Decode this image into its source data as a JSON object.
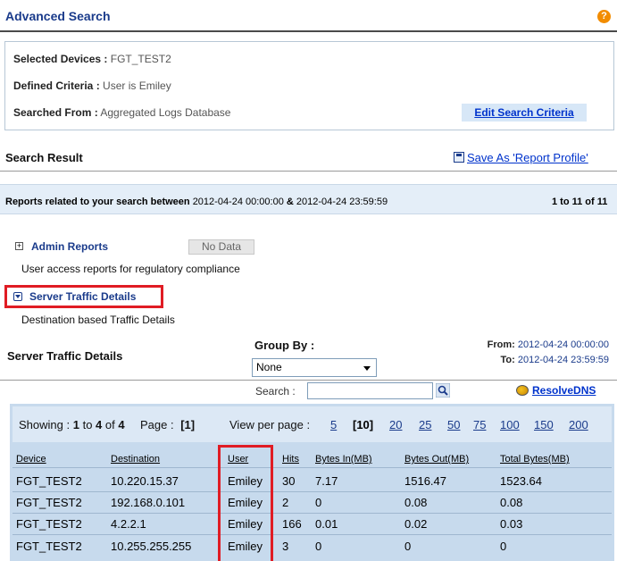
{
  "header": {
    "title": "Advanced Search",
    "help_glyph": "?"
  },
  "criteria": {
    "selected_devices_label": "Selected Devices :",
    "selected_devices_value": "FGT_TEST2",
    "defined_criteria_label": "Defined Criteria :",
    "defined_criteria_value": "User is Emiley",
    "searched_from_label": "Searched From :",
    "searched_from_value": "Aggregated Logs Database",
    "edit_button": "Edit Search Criteria"
  },
  "result": {
    "title": "Search  Result",
    "save_link": "Save  As  'Report  Profile'"
  },
  "report_band": {
    "prefix": "Reports related to your search between",
    "start": "2012-04-24 00:00:00",
    "amp": "&",
    "end": "2012-04-24 23:59:59",
    "count": "1 to 11 of 11"
  },
  "categories": {
    "admin": {
      "icon_glyph": "+",
      "label": "Admin Reports",
      "badge": "No Data",
      "desc": "User access reports for regulatory compliance"
    },
    "server": {
      "label": "Server Traffic Details",
      "desc": "Destination based Traffic Details"
    }
  },
  "section": {
    "title": "Server  Traffic  Details",
    "group_by_label": "Group  By  :",
    "group_by_value": "None",
    "from_label": "From:",
    "from_value": "2012-04-24  00:00:00",
    "to_label": "To:",
    "to_value": "2012-04-24  23:59:59",
    "search_label": "Search :",
    "search_value": "",
    "resolve_label": "ResolveDNS"
  },
  "pager": {
    "showing_prefix": "Showing :",
    "showing_range": "1",
    "to_word": "to",
    "showing_end": "4",
    "of_word": "of",
    "showing_total": "4",
    "page_label": "Page :",
    "page_value": "[1]",
    "view_per_page_label": "View per page :",
    "options": [
      "5",
      "[10]",
      "20",
      "25",
      "50",
      "75",
      "100",
      "150",
      "200"
    ]
  },
  "table": {
    "columns": [
      "Device",
      "Destination",
      "User",
      "Hits",
      "Bytes In(MB)",
      "Bytes Out(MB)",
      "Total Bytes(MB)"
    ],
    "rows": [
      [
        "FGT_TEST2",
        "10.220.15.37",
        "Emiley",
        "30",
        "7.17",
        "1516.47",
        "1523.64"
      ],
      [
        "FGT_TEST2",
        "192.168.0.101",
        "Emiley",
        "2",
        "0",
        "0.08",
        "0.08"
      ],
      [
        "FGT_TEST2",
        "4.2.2.1",
        "Emiley",
        "166",
        "0.01",
        "0.02",
        "0.03"
      ],
      [
        "FGT_TEST2",
        "10.255.255.255",
        "Emiley",
        "3",
        "0",
        "0",
        "0"
      ]
    ]
  },
  "colors": {
    "accent": "#1a3b8b",
    "highlight": "#e01c24",
    "panel": "#c7daed",
    "band": "#e4eef8"
  }
}
